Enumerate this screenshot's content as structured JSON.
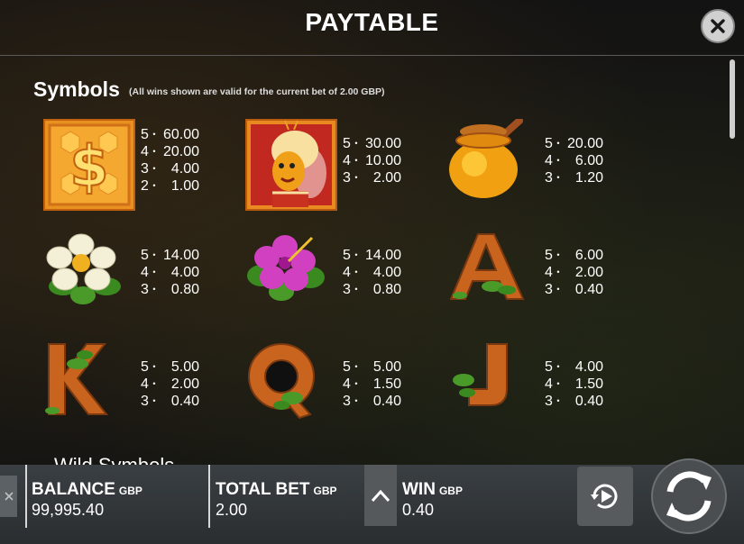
{
  "header": {
    "title": "PAYTABLE"
  },
  "section": {
    "title": "Symbols",
    "note": "(All wins shown are valid for the current bet of 2.00 GBP)"
  },
  "symbols": [
    {
      "name": "dollar-coin",
      "icon": "dollar-icon",
      "pays": [
        [
          "5",
          "60.00"
        ],
        [
          "4",
          "20.00"
        ],
        [
          "3",
          "4.00"
        ],
        [
          "2",
          "1.00"
        ]
      ]
    },
    {
      "name": "queen-bee",
      "icon": "queen-bee-icon",
      "pays": [
        [
          "5",
          "30.00"
        ],
        [
          "4",
          "10.00"
        ],
        [
          "3",
          "2.00"
        ]
      ]
    },
    {
      "name": "honey-pot",
      "icon": "honey-pot-icon",
      "pays": [
        [
          "5",
          "20.00"
        ],
        [
          "4",
          "6.00"
        ],
        [
          "3",
          "1.20"
        ]
      ]
    },
    {
      "name": "white-flower",
      "icon": "white-flower-icon",
      "pays": [
        [
          "5",
          "14.00"
        ],
        [
          "4",
          "4.00"
        ],
        [
          "3",
          "0.80"
        ]
      ]
    },
    {
      "name": "pink-flower",
      "icon": "hibiscus-icon",
      "pays": [
        [
          "5",
          "14.00"
        ],
        [
          "4",
          "4.00"
        ],
        [
          "3",
          "0.80"
        ]
      ]
    },
    {
      "name": "letter-a",
      "icon": "wooden-a-icon",
      "pays": [
        [
          "5",
          "6.00"
        ],
        [
          "4",
          "2.00"
        ],
        [
          "3",
          "0.40"
        ]
      ]
    },
    {
      "name": "letter-k",
      "icon": "wooden-k-icon",
      "pays": [
        [
          "5",
          "5.00"
        ],
        [
          "4",
          "2.00"
        ],
        [
          "3",
          "0.40"
        ]
      ]
    },
    {
      "name": "letter-q",
      "icon": "wooden-q-icon",
      "pays": [
        [
          "5",
          "5.00"
        ],
        [
          "4",
          "1.50"
        ],
        [
          "3",
          "0.40"
        ]
      ]
    },
    {
      "name": "letter-j",
      "icon": "wooden-j-icon",
      "pays": [
        [
          "5",
          "4.00"
        ],
        [
          "4",
          "1.50"
        ],
        [
          "3",
          "0.40"
        ]
      ]
    }
  ],
  "wild_section": {
    "title": "Wild Symbols"
  },
  "footer": {
    "balance_label": "BALANCE",
    "balance_currency": "GBP",
    "balance_value": "99,995.40",
    "bet_label": "TOTAL BET",
    "bet_currency": "GBP",
    "bet_value": "2.00",
    "win_label": "WIN",
    "win_currency": "GBP",
    "win_value": "0.40"
  },
  "colors": {
    "wood": "#c8641e",
    "gold": "#f0a020",
    "leaf": "#4a9a2a",
    "pink": "#d040c0"
  }
}
